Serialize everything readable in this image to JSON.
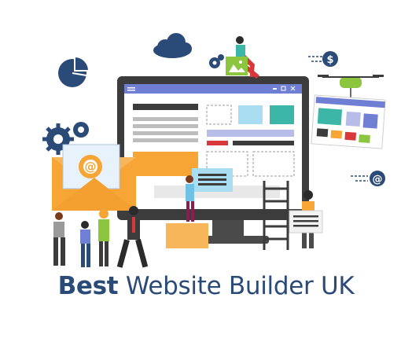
{
  "title": {
    "bold": "Best",
    "rest": " Website Builder UK"
  },
  "badges": {
    "dollar": "$",
    "at": "@",
    "email_at": "@"
  },
  "colors": {
    "navy": "#2a4a78",
    "gray_dark": "#4b4b4b",
    "blue_bar": "#6f7fd4",
    "orange": "#f7a535",
    "teal": "#3bb6a7",
    "light_blue": "#a9ddf2",
    "red": "#d9383a",
    "green": "#8cc63f"
  },
  "icons": [
    "cloud-icon",
    "pie-chart-icon",
    "gear-icon",
    "envelope-icon",
    "dollar-badge-icon",
    "at-badge-icon",
    "drone-icon",
    "ladder-icon"
  ]
}
